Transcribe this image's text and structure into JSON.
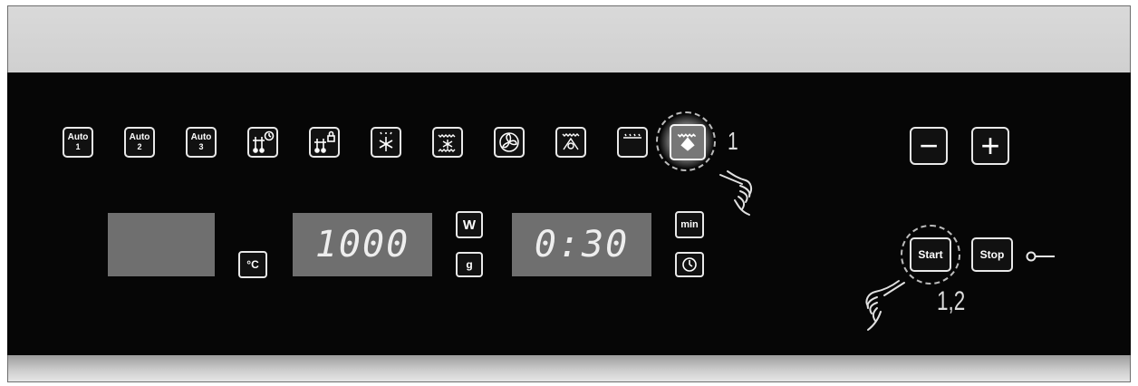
{
  "program_keys": [
    {
      "name": "auto-1-button",
      "line1": "Auto",
      "line2": "1"
    },
    {
      "name": "auto-2-button",
      "line1": "Auto",
      "line2": "2"
    },
    {
      "name": "auto-3-button",
      "line1": "Auto",
      "line2": "3"
    }
  ],
  "displays": {
    "temperature": "",
    "power": "1000",
    "time": "0:30"
  },
  "units": {
    "celsius": "°C",
    "watt": "W",
    "gram": "g",
    "minutes": "min"
  },
  "controls": {
    "minus": "−",
    "plus": "+",
    "start": "Start",
    "stop": "Stop"
  },
  "callouts": {
    "function_step": "1",
    "start_steps": "1,2"
  },
  "icons": {
    "timer-keep-warm": "sensor-clock-icon",
    "sensor-lock": "sensor-lock-icon",
    "defrost": "snowflake-icon",
    "combi": "combi-grill-icon",
    "fan": "fan-icon",
    "grill-fan": "grill-fan-icon",
    "top-heat": "top-heat-icon",
    "selected-mode": "grill-icon",
    "key": "key-icon",
    "hand": "pointing-hand-icon"
  },
  "colors": {
    "panel": "#060606",
    "display": "#6f6f6f",
    "frame": "#c2c2c2"
  }
}
